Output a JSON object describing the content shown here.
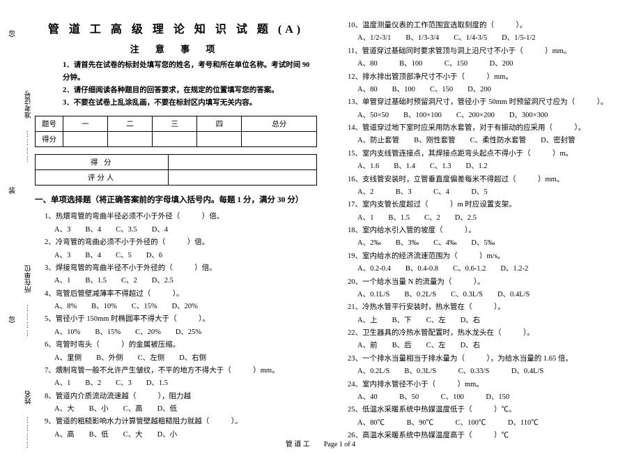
{
  "margin": {
    "c1": "忽",
    "c2": "准考证号",
    "c3": "装",
    "c4": "所在单位",
    "c5": "忽",
    "c6": "姓名",
    "dots": "…………"
  },
  "title": "管 道 工 高 级 理 论 知 识 试 题 (A)",
  "subtitle": "注  意    事  项",
  "instructions": [
    "1．请首先在试卷的标封处填写您的姓名，考号和所在单位名称。考试时间 90 分钟。",
    "2．请仔细阅读各种题目的回答要求，在规定的位置填写您的答案。",
    "3．不要在试卷上乱涂乱画，不要在标封区内填写无关内容。"
  ],
  "score_table": {
    "row1": [
      "题号",
      "一",
      "二",
      "三",
      "四",
      "总分"
    ],
    "row2": [
      "得分",
      "",
      "",
      "",
      "",
      ""
    ]
  },
  "grader_table": {
    "r1": [
      "得 分",
      ""
    ],
    "r2": [
      "评分人",
      ""
    ]
  },
  "section1": "一、单项选择题（将正确答案前的字母填入括号内。每题 1 分，满分 30 分）",
  "q1": {
    "stem": "1、热煨弯管的弯曲半径必须不小于外径（　　　）倍。",
    "opts": "A、3　　B、4　　C、3.5　　D、4"
  },
  "q2": {
    "stem": "2、冷弯管的弯曲必须不小于外径的（　　　）倍。",
    "opts": "A、3　　B、4　　C、5　　D、6"
  },
  "q3": {
    "stem": "3、焊接弯管的弯曲半径不小于外径的（　　　）倍。",
    "opts": "A、1　　B、1.5　　C、2　　D、2.5"
  },
  "q4": {
    "stem": "4、弯管后管壁减薄率不得超过（　　　）。",
    "opts": "A、8%　　B、10%　　C、15%　　D、20%"
  },
  "q5": {
    "stem": "5、管径小于 150mm 时椭圆率不得大于（　　　）。",
    "opts": "A、10%　　B、15%　　C、20%　　D、25%"
  },
  "q6": {
    "stem": "6、弯管时弯头（　　　）的金属被压缩。",
    "opts": "A、里侧　　B、外侧　　C、左侧　　D、右侧"
  },
  "q7": {
    "stem": "7、煨制弯管一般不允许产生皱纹，不平的地方不得大于（　　　）mm。",
    "opts": "A、1　　B、2　　C、3　　D、1.5"
  },
  "q8": {
    "stem": "8、管道内介质流动流速越（　　　），阻力越",
    "opts": "A、大　　B、小　　C、高　　D、低"
  },
  "q9": {
    "stem": "9、管道的粗糙影响水力计算管壁越粗糙阻力就越（　　　）。",
    "opts": "A、高　　B、低　　C、大　　D、小"
  },
  "q10": {
    "stem": "10、温度测量仪表的工作范围宜选取刻度的（　　　）。",
    "opts": "A、1/2-3/1　　B、1/3-3/4　　C、1/4-3/5　　D、1/5-1/2"
  },
  "q11": {
    "stem": "11、管道穿过基础同时要求管顶与洞上沿尺寸不小于（　　　）mm。",
    "opts": "A、80　　　B、100　　　C、150　　　D、200"
  },
  "q12": {
    "stem": "12、排水排出管顶部净尺寸不小于（　　　）mm。",
    "opts": "A、80　　B、100　　C、150　　D、200"
  },
  "q13": {
    "stem": "13、单管穿过基础时预留洞尺寸，管径小于 50mm 时预留洞尺寸应为（　　　）。",
    "opts": "A、50×50　　B、100×100　　C、200×200　　D、300×300"
  },
  "q14": {
    "stem": "14、管道穿过地下室时应采用防水套管，对于有振动的应采用（　　　）。",
    "opts": "A、防止套管　　B、刚性套管　　C、柔性防水套管　　D、密封管"
  },
  "q15": {
    "stem": "15、室内支线管连接点，其焊接点距弯头起点不得小于（　　　）m。",
    "opts": "A、1.6　　B、1.4　　C、1.3　　D、1.2"
  },
  "q16": {
    "stem": "16、支线管安装时，立管垂直度偏差每米不得超过（　　　）mm。",
    "opts": "A、2　　　B、3　　　C、4　　　D、5"
  },
  "q17": {
    "stem": "17、室内支管长度超过（　　　）m 时应设置支架。",
    "opts": "A、1　　B、1.5　　C、2　　D、2.5"
  },
  "q18": {
    "stem": "18、室内给水引入管的坡度（　　　）。",
    "opts": "A、2‰　　B、3‰　　C、4‰　　D、5‰"
  },
  "q19": {
    "stem": "19、室内给水的经济流速范围为（　　　）m/s。",
    "opts": "A、0.2-0.4　　B、0.4-0.8　　C、0.6-1.2　　D、1.2-2"
  },
  "q20": {
    "stem": "20、一个给水当量 N 的流量为（　　　）。",
    "opts": "A、0.1L/S　　B、0.2L/S　　C、0.3L/S　　D、0.4L/S"
  },
  "q21": {
    "stem": "21、冷热水管平行安装时，热水管在（　　　）。",
    "opts": "A、上　　B、下　　C、左　　D、右"
  },
  "q22": {
    "stem": "22、卫生器具的冷热水管配置时，热水龙头在（　　　）。",
    "opts": "A、前　　B、后　　C、左　　D、右"
  },
  "q23": {
    "stem": "23、一个排水当量相当于排水量为（　　　），为给水当量的 1.65 倍。",
    "opts": "A、0.2L/S　　B、0.3L/S　　　C、0.33/S　　　D、0.4L/S"
  },
  "q24": {
    "stem": "24、室内排水管径不小于（　　　）mm。",
    "opts": "A、40　　　B、50　　　C、100　　　D、150"
  },
  "q25": {
    "stem": "25、低温水采暖系统中热媒温度低于（　　　）℃。",
    "opts": "A、80℃　　　B、90℃　　　C、100℃　　　D、110℃"
  },
  "q26": {
    "stem": "26、高温水采暖系统中热媒温度高于（　　　）℃"
  },
  "footer": "管 道 工　　Page 1 of 4"
}
